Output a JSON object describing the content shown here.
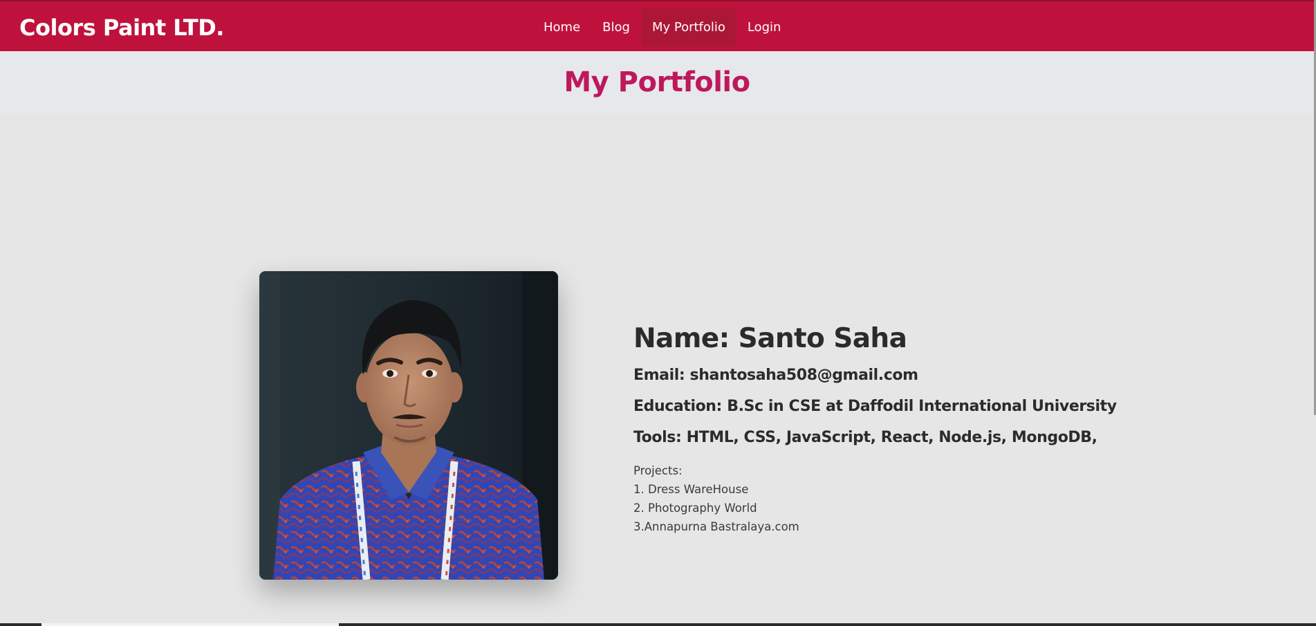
{
  "navbar": {
    "brand": "Colors Paint LTD.",
    "links": [
      {
        "label": "Home",
        "active": false
      },
      {
        "label": "Blog",
        "active": false
      },
      {
        "label": "My Portfolio",
        "active": true
      },
      {
        "label": "Login",
        "active": false
      }
    ],
    "background_color": "#be123c"
  },
  "page": {
    "title": "My Portfolio",
    "title_color": "#be185d"
  },
  "profile": {
    "photo_icon": "profile-photo",
    "name": "Name: Santo Saha",
    "email": "Email: shantosaha508@gmail.com",
    "education": "Education: B.Sc in CSE at Daffodil International University",
    "tools": "Tools: HTML, CSS, JavaScript, React, Node.js, MongoDB,",
    "projects_heading": "Projects:",
    "projects": [
      "1. Dress WareHouse",
      "2. Photography World",
      "3.Annapurna Bastralaya.com"
    ]
  }
}
